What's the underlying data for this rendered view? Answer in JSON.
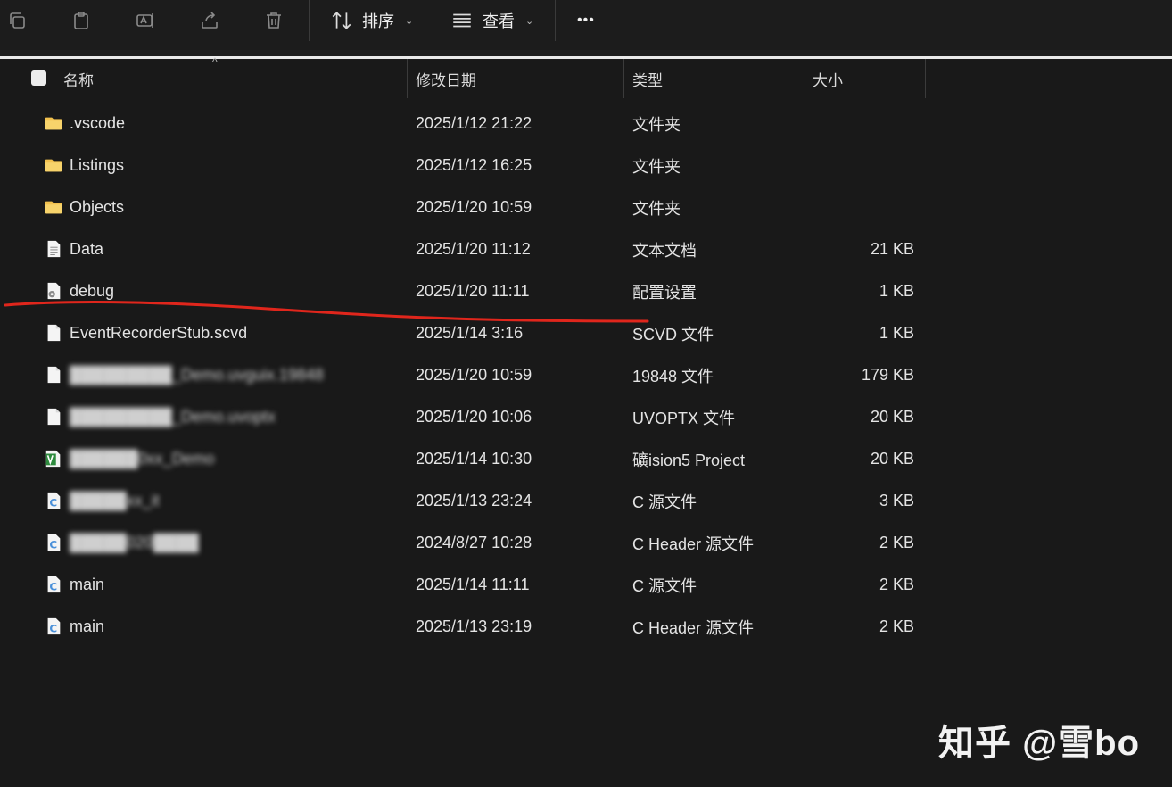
{
  "toolbar": {
    "icons": [
      "copy-icon",
      "paste-icon",
      "rename-icon",
      "share-icon",
      "delete-icon"
    ],
    "sort_label": "排序",
    "view_label": "查看",
    "more_label": "•••"
  },
  "columns": {
    "name": "名称",
    "date": "修改日期",
    "type": "类型",
    "size": "大小"
  },
  "files": [
    {
      "icon": "folder-icon",
      "name": ".vscode",
      "date": "2025/1/12 21:22",
      "type": "文件夹",
      "size": ""
    },
    {
      "icon": "folder-icon",
      "name": "Listings",
      "date": "2025/1/12 16:25",
      "type": "文件夹",
      "size": ""
    },
    {
      "icon": "folder-icon",
      "name": "Objects",
      "date": "2025/1/20 10:59",
      "type": "文件夹",
      "size": ""
    },
    {
      "icon": "text-file-icon",
      "name": "Data",
      "date": "2025/1/20 11:12",
      "type": "文本文档",
      "size": "21 KB"
    },
    {
      "icon": "settings-file-icon",
      "name": "debug",
      "date": "2025/1/20 11:11",
      "type": "配置设置",
      "size": "1 KB"
    },
    {
      "icon": "blank-file-icon",
      "name": "EventRecorderStub.scvd",
      "date": "2025/1/14 3:16",
      "type": "SCVD 文件",
      "size": "1 KB"
    },
    {
      "icon": "blank-file-icon",
      "name": "█████████_Demo.uvguix.19848",
      "date": "2025/1/20 10:59",
      "type": "19848 文件",
      "size": "179 KB"
    },
    {
      "icon": "blank-file-icon",
      "name": "█████████_Demo.uvoptx",
      "date": "2025/1/20 10:06",
      "type": "UVOPTX 文件",
      "size": "20 KB"
    },
    {
      "icon": "keil-project-icon",
      "name": "██████0xx_Demo",
      "date": "2025/1/14 10:30",
      "type": "礦ision5 Project",
      "size": "20 KB"
    },
    {
      "icon": "c-source-icon",
      "name": "█████xx_it",
      "date": "2025/1/13 23:24",
      "type": "C 源文件",
      "size": "3 KB"
    },
    {
      "icon": "c-header-icon",
      "name": "█████020████",
      "date": "2024/8/27 10:28",
      "type": "C Header 源文件",
      "size": "2 KB"
    },
    {
      "icon": "c-source-icon",
      "name": "main",
      "date": "2025/1/14 11:11",
      "type": "C 源文件",
      "size": "2 KB"
    },
    {
      "icon": "c-header-icon",
      "name": "main",
      "date": "2025/1/13 23:19",
      "type": "C Header 源文件",
      "size": "2 KB"
    }
  ],
  "watermark": "知乎 @雪bo",
  "colors": {
    "background": "#191919",
    "folder": "#f2c14e",
    "annotation": "#e0261c",
    "c_icon": "#4a90d9"
  }
}
